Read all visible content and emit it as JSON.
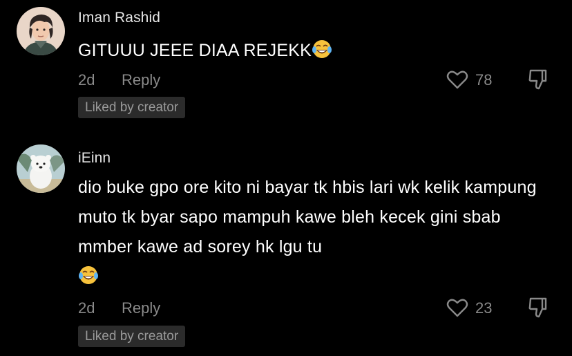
{
  "colors": {
    "background": "#000000",
    "text_primary": "#ffffff",
    "text_secondary": "#8a8a8a",
    "badge_bg": "#2b2b2b"
  },
  "comments": [
    {
      "username": "Iman Rashid",
      "avatar_icon": "avatar-cartoon-man",
      "text": "GITUUU JEEE DIAA REJEKK",
      "emoji_icon": "face-with-tears-of-joy-icon",
      "time": "2d",
      "reply_label": "Reply",
      "like_count": "78",
      "badge": "Liked by creator"
    },
    {
      "username": "iEinn",
      "avatar_icon": "avatar-white-bear",
      "text": "dio buke gpo ore kito ni bayar tk hbis lari wk kelik kampung muto tk byar sapo mampuh kawe bleh kecek gini sbab mmber kawe ad sorey hk lgu tu",
      "emoji_icon": "face-with-tears-of-joy-icon",
      "time": "2d",
      "reply_label": "Reply",
      "like_count": "23",
      "badge": "Liked by creator"
    }
  ]
}
